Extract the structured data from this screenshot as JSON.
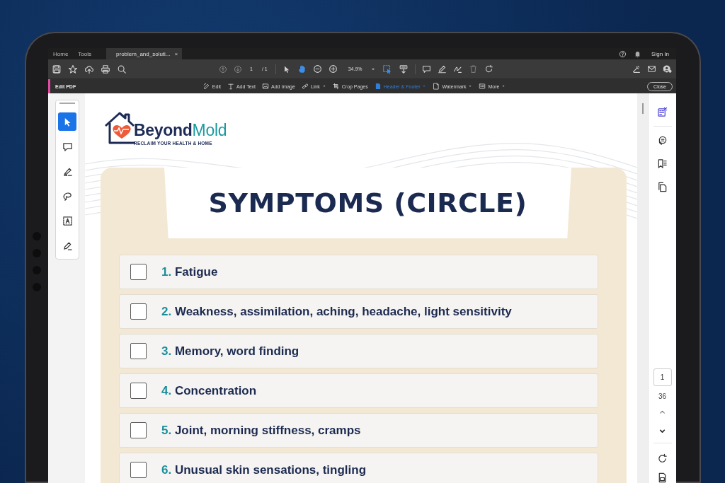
{
  "tabs": [
    {
      "label": "Home",
      "selected": false,
      "closable": false
    },
    {
      "label": "Tools",
      "selected": false,
      "closable": false
    },
    {
      "label": "problem_and_soluti...",
      "selected": true,
      "closable": true,
      "close_glyph": "×"
    }
  ],
  "account": {
    "sign_in": "Sign In"
  },
  "toolbar": {
    "page": "1",
    "page_total": "/ 1",
    "zoom": "34.9%",
    "tools": [
      {
        "kind": "pointer",
        "selected": false
      },
      {
        "kind": "hand",
        "selected": true
      }
    ]
  },
  "edit_bar": {
    "title": "Edit PDF",
    "close": "Close",
    "tools": [
      {
        "label": "Edit",
        "kind": "edit",
        "dropdown": false,
        "selected": false
      },
      {
        "label": "Add Text",
        "kind": "text",
        "dropdown": false,
        "selected": false
      },
      {
        "label": "Add Image",
        "kind": "image",
        "dropdown": false,
        "selected": false
      },
      {
        "label": "Link",
        "kind": "link",
        "dropdown": true,
        "selected": false
      },
      {
        "label": "Crop Pages",
        "kind": "crop",
        "dropdown": false,
        "selected": false
      },
      {
        "label": "Header & Footer",
        "kind": "header",
        "dropdown": true,
        "selected": true
      },
      {
        "label": "Watermark",
        "kind": "watermark",
        "dropdown": true,
        "selected": false
      },
      {
        "label": "More",
        "kind": "more",
        "dropdown": true,
        "selected": false
      }
    ]
  },
  "quick_tools": [
    {
      "kind": "pointer",
      "selected": true
    },
    {
      "kind": "comment",
      "selected": false
    },
    {
      "kind": "highlighter",
      "selected": false
    },
    {
      "kind": "lasso",
      "selected": false
    },
    {
      "kind": "textbox",
      "selected": false
    },
    {
      "kind": "sign",
      "selected": false
    }
  ],
  "document": {
    "logo": {
      "brand_1": "Beyond",
      "brand_2": "Mold",
      "tagline": "RECLAIM YOUR HEALTH & HOME"
    },
    "title": "SYMPTOMS (CIRCLE)",
    "items": [
      {
        "number": "1.",
        "text": "Fatigue",
        "checked": false
      },
      {
        "number": "2.",
        "text": "Weakness, assimilation, aching, headache, light sensitivity",
        "checked": false
      },
      {
        "number": "3.",
        "text": "Memory, word finding",
        "checked": false
      },
      {
        "number": "4.",
        "text": "Concentration",
        "checked": false
      },
      {
        "number": "5.",
        "text": "Joint, morning stiffness, cramps",
        "checked": false
      },
      {
        "number": "6.",
        "text": "Unusual skin sensations, tingling",
        "checked": false
      }
    ]
  },
  "right_panel": {
    "tools": [
      {
        "kind": "edit-pdf",
        "selected": true
      },
      {
        "kind": "comment",
        "selected": false
      },
      {
        "kind": "bookmark",
        "selected": false
      },
      {
        "kind": "pages",
        "selected": false
      }
    ],
    "page": "1",
    "page_count": "36"
  }
}
